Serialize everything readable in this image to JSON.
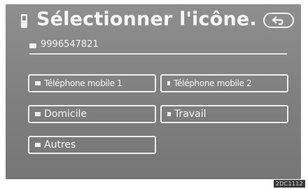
{
  "header": {
    "title": "Sélectionner l'icône.",
    "phone_icon": "mobile-phone-icon",
    "back_icon": "return-arrow-icon"
  },
  "entry": {
    "number": "9996547821",
    "icon": "phone-number-icon"
  },
  "buttons": [
    {
      "label": "Téléphone mobile 1",
      "icon": "mobile-phone-icon"
    },
    {
      "label": "Téléphone mobile 2",
      "icon": "mobile-phone-icon"
    },
    {
      "label": "Domicile",
      "icon": "home-icon"
    },
    {
      "label": "Travail",
      "icon": "work-icon"
    },
    {
      "label": "Autres",
      "icon": "other-icon"
    }
  ],
  "footer": {
    "code": "2DC1112"
  },
  "colors": {
    "screen_bg": "#858585",
    "text": "#f6f6f6"
  }
}
